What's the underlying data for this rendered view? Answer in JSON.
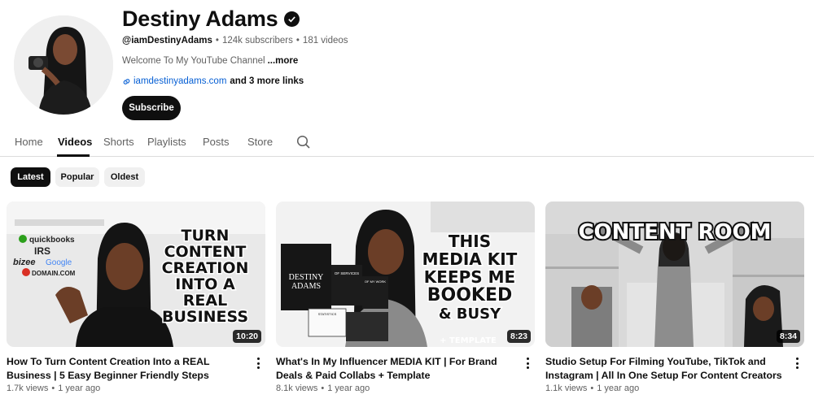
{
  "channel": {
    "name": "Destiny Adams",
    "handle": "@iamDestinyAdams",
    "subscribers": "124k subscribers",
    "videos_count": "181 videos",
    "description": "Welcome To My YouTube Channel",
    "more_label": "...more",
    "link": "iamdestinyadams.com",
    "more_links": "and 3 more links",
    "subscribe_label": "Subscribe"
  },
  "tabs": [
    {
      "label": "Home",
      "active": false
    },
    {
      "label": "Videos",
      "active": true
    },
    {
      "label": "Shorts",
      "active": false
    },
    {
      "label": "Playlists",
      "active": false
    },
    {
      "label": "Posts",
      "active": false
    },
    {
      "label": "Store",
      "active": false
    }
  ],
  "chips": [
    {
      "label": "Latest",
      "active": true
    },
    {
      "label": "Popular",
      "active": false
    },
    {
      "label": "Oldest",
      "active": false
    }
  ],
  "videos": [
    {
      "title": "How To Turn Content Creation Into a REAL Business | 5 Easy Beginner Friendly Steps",
      "views": "1.7k views",
      "age": "1 year ago",
      "duration": "10:20",
      "thumb_text": [
        "TURN",
        "CONTENT",
        "CREATION",
        "INTO A",
        "REAL",
        "BUSINESS"
      ],
      "thumb_logos": [
        "quickbooks",
        "IRS",
        "bizee",
        "Google",
        "DOMAIN.COM"
      ]
    },
    {
      "title": "What's In My Influencer MEDIA KIT | For Brand Deals & Paid Collabs + Template",
      "views": "8.1k views",
      "age": "1 year ago",
      "duration": "8:23",
      "thumb_text": [
        "THIS",
        "MEDIA KIT",
        "KEEPS ME",
        "BOOKED",
        "& BUSY",
        "+ TEMPLATE"
      ],
      "thumb_doc": [
        "DESTINY",
        "ADAMS",
        "OF SERVICES",
        "OF MY WORK",
        "STATISTICS"
      ]
    },
    {
      "title": "Studio Setup For Filming YouTube, TikTok and Instagram | All In One Setup For Content Creators",
      "views": "1.1k views",
      "age": "1 year ago",
      "duration": "8:34",
      "thumb_text": [
        "CONTENT ROOM"
      ]
    }
  ],
  "colors": {
    "link": "#065fd4",
    "text_primary": "#0f0f0f",
    "text_secondary": "#606060",
    "chip_bg": "#f0f0f0"
  },
  "icons": [
    "verified-badge-icon",
    "link-icon",
    "search-icon",
    "more-vert-icon"
  ]
}
